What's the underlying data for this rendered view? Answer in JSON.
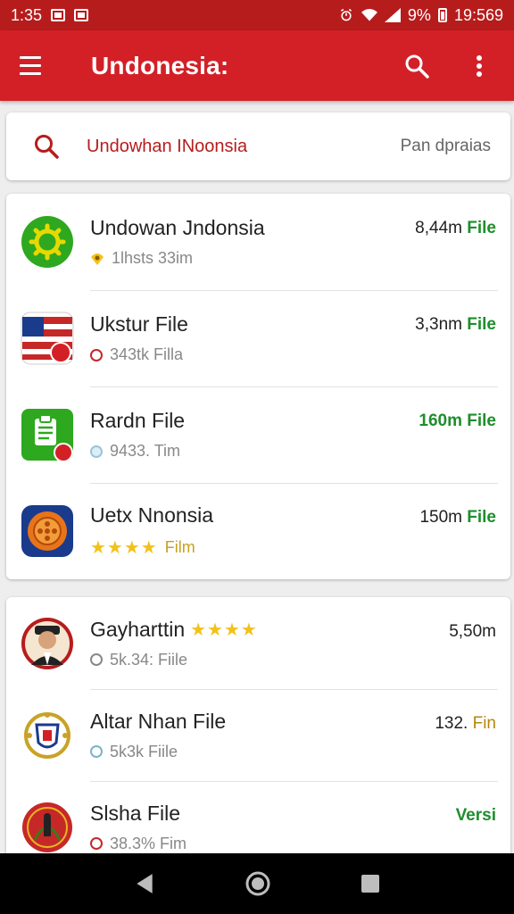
{
  "status_bar": {
    "time_left": "1:35",
    "battery_text": "9%",
    "time_right": "19:569"
  },
  "app_bar": {
    "title": "Undonesia:",
    "menu_icon": "menu-icon",
    "search_icon": "search-icon",
    "more_icon": "more-vert-icon"
  },
  "search": {
    "query": "Undowhan INoonsia",
    "hint": "Pan dpraias"
  },
  "list_primary": [
    {
      "title": "Undowan Jndonsia",
      "subtitle": "1lhsts 33im",
      "size": "8,44m",
      "tag": "File",
      "icon": "gear-app-icon",
      "badge": "pin-badge"
    },
    {
      "title": "Ukstur File",
      "subtitle": "343tk Filla",
      "size": "3,3nm",
      "tag": "File",
      "icon": "flag-app-icon",
      "badge": "ring-badge"
    },
    {
      "title": "Rardn File",
      "subtitle": "9433. Tim",
      "size": "160m",
      "tag": "File",
      "icon": "clipboard-app-icon",
      "badge": "blue-dot-badge"
    },
    {
      "title": "Uetx Nnonsia",
      "subtitle": "Film",
      "size": "150m",
      "tag": "File",
      "icon": "ornament-app-icon",
      "badge": "stars"
    }
  ],
  "list_secondary": [
    {
      "title": "Gayharttin",
      "subtitle": "5k.34: Fiile",
      "size": "5,50m",
      "tag": "",
      "icon": "portrait-app-icon"
    },
    {
      "title": "Altar Nhan File",
      "subtitle": "5k3k Fiile",
      "size": "132.",
      "tag": "Fin",
      "icon": "emblem-app-icon"
    },
    {
      "title": "Slsha File",
      "subtitle": "38.3% Fim",
      "size": "",
      "tag": "Versi",
      "icon": "seal-app-icon"
    }
  ],
  "colors": {
    "primary": "#d32027",
    "status_bar": "#b71c1c",
    "accent_green": "#1e8e2c",
    "star": "#f2c21b"
  }
}
